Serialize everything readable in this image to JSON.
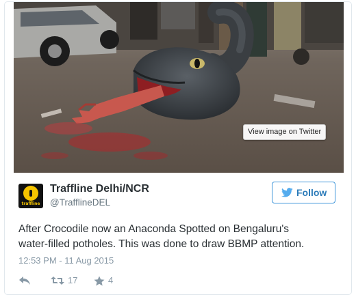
{
  "media": {
    "badge_label": "View image on Twitter",
    "colors": {
      "road": "#6b5f55",
      "snake": "#3e4347",
      "blood": "#b3262a"
    }
  },
  "user": {
    "display_name": "Traffline Delhi/NCR",
    "handle": "@TrafflineDEL",
    "avatar_text": "traffline",
    "avatar_color": "#f5c400"
  },
  "follow": {
    "label": "Follow",
    "icon": "twitter-bird-icon"
  },
  "tweet": {
    "line1": "After Crocodile now an Anaconda Spotted on Bengaluru's",
    "line2": "water-filled potholes. This was done to draw BBMP attention.",
    "timestamp": "12:53 PM - 11 Aug 2015"
  },
  "actions": {
    "reply_icon": "reply-icon",
    "retweet_icon": "retweet-icon",
    "retweet_count": "17",
    "favorite_icon": "star-icon",
    "favorite_count": "4"
  }
}
